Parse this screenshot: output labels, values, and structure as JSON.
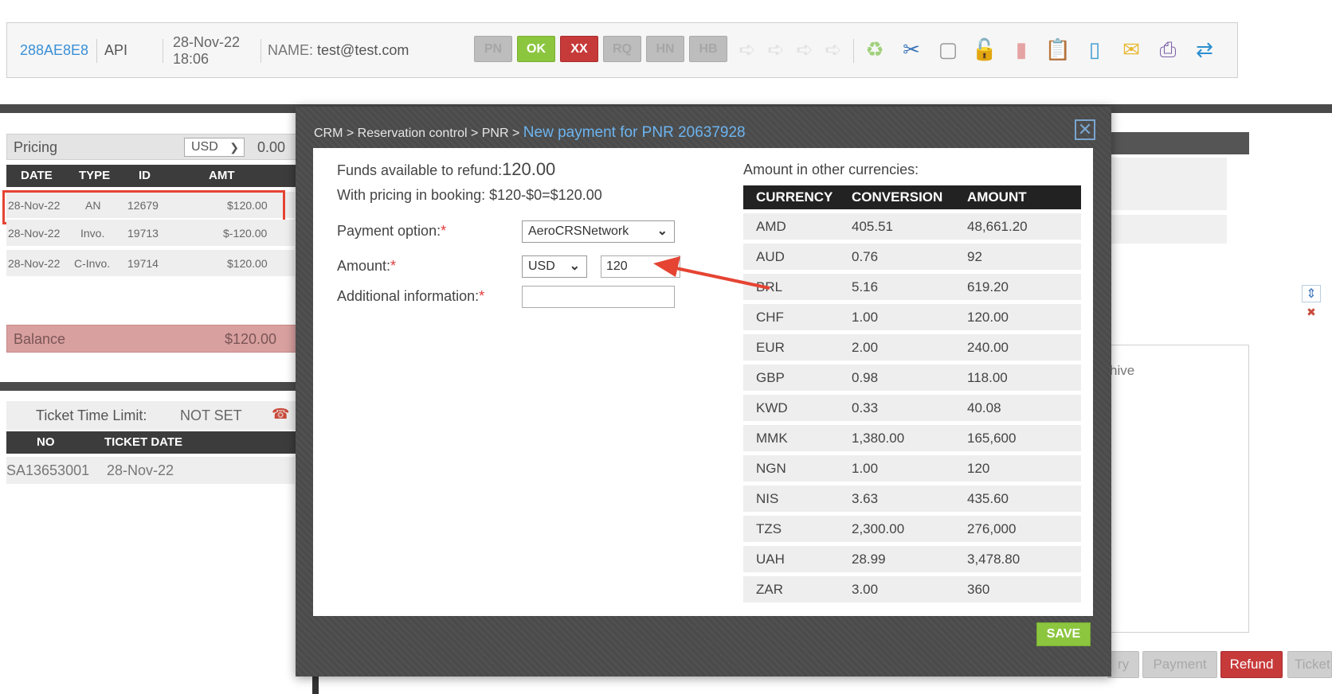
{
  "header": {
    "pnr_code": "288AE8E8",
    "source": "API",
    "date": "28-Nov-22",
    "time": "18:06",
    "name_label": "NAME:",
    "name_value": "test@test.com",
    "status_buttons": [
      "PN",
      "OK",
      "XX",
      "RQ",
      "HN",
      "HB"
    ],
    "icons": [
      "arrow-right-icon",
      "arrow-right-icon",
      "arrow-right-icon",
      "arrow-right-icon",
      "recycle-icon",
      "scissors-icon",
      "edit-document-icon",
      "unlock-icon",
      "trash-icon",
      "clipboard-icon",
      "bottle-icon",
      "envelope-icon",
      "printer-icon",
      "sync-icon"
    ]
  },
  "pricing": {
    "label": "Pricing",
    "currency": "USD",
    "amount": "0.00",
    "columns": [
      "DATE",
      "TYPE",
      "ID",
      "AMT"
    ],
    "rows": [
      {
        "date": "28-Nov-22",
        "type": "AN",
        "id": "12679",
        "amt": "$120.00"
      },
      {
        "date": "28-Nov-22",
        "type": "Invo.",
        "id": "19713",
        "amt": "$-120.00"
      },
      {
        "date": "28-Nov-22",
        "type": "C-Invo.",
        "id": "19714",
        "amt": "$120.00"
      }
    ],
    "balance_label": "Balance",
    "balance_value": "$120.00"
  },
  "tickets": {
    "time_limit_label": "Ticket Time Limit:",
    "time_limit_value": "NOT SET",
    "columns": [
      "NO",
      "TICKET DATE"
    ],
    "rows": [
      {
        "no": "SA13653001",
        "date": "28-Nov-22"
      }
    ]
  },
  "right_panel": {
    "partial_text": "hive"
  },
  "bottom_buttons": {
    "b1": "ry",
    "payment": "Payment",
    "refund": "Refund",
    "ticket": "Ticket"
  },
  "modal": {
    "breadcrumb_path": "CRM > Reservation control > PNR >",
    "breadcrumb_current": "New payment for PNR 20637928",
    "close_icon": "close-icon",
    "funds_label": "Funds available to refund:",
    "funds_value": "120.00",
    "pricing_info": "With pricing in booking: $120-$0=$120.00",
    "payment_option_label": "Payment option:",
    "payment_option_value": "AeroCRSNetwork",
    "amount_label": "Amount:",
    "amount_currency": "USD",
    "amount_value": "120",
    "additional_info_label": "Additional information:",
    "additional_info_value": "",
    "required_mark": "*",
    "other_currencies_label": "Amount in other currencies:",
    "currency_columns": [
      "CURRENCY",
      "CONVERSION",
      "AMOUNT"
    ],
    "currency_rows": [
      {
        "currency": "AMD",
        "conversion": "405.51",
        "amount": "48,661.20"
      },
      {
        "currency": "AUD",
        "conversion": "0.76",
        "amount": "92"
      },
      {
        "currency": "BRL",
        "conversion": "5.16",
        "amount": "619.20"
      },
      {
        "currency": "CHF",
        "conversion": "1.00",
        "amount": "120.00"
      },
      {
        "currency": "EUR",
        "conversion": "2.00",
        "amount": "240.00"
      },
      {
        "currency": "GBP",
        "conversion": "0.98",
        "amount": "118.00"
      },
      {
        "currency": "KWD",
        "conversion": "0.33",
        "amount": "40.08"
      },
      {
        "currency": "MMK",
        "conversion": "1,380.00",
        "amount": "165,600"
      },
      {
        "currency": "NGN",
        "conversion": "1.00",
        "amount": "120"
      },
      {
        "currency": "NIS",
        "conversion": "3.63",
        "amount": "435.60"
      },
      {
        "currency": "TZS",
        "conversion": "2,300.00",
        "amount": "276,000"
      },
      {
        "currency": "UAH",
        "conversion": "28.99",
        "amount": "3,478.80"
      },
      {
        "currency": "ZAR",
        "conversion": "3.00",
        "amount": "360"
      }
    ],
    "save_label": "SAVE"
  },
  "colors": {
    "accent_blue": "#3a8fd6",
    "ok_green": "#8cc63f",
    "cancel_red": "#c73a3a",
    "highlight_red": "#e54433"
  }
}
